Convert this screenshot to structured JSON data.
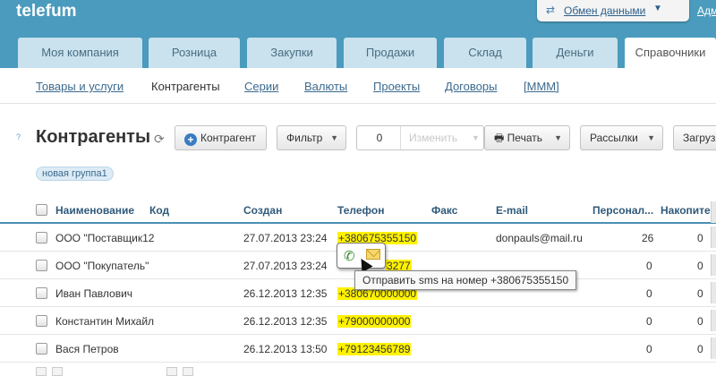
{
  "header": {
    "logo": "telefum",
    "exchange_label": "Обмен данными",
    "admin_label": "Адм"
  },
  "tabs": [
    {
      "label": "Моя компания"
    },
    {
      "label": "Розница"
    },
    {
      "label": "Закупки"
    },
    {
      "label": "Продажи"
    },
    {
      "label": "Склад"
    },
    {
      "label": "Деньги"
    },
    {
      "label": "Справочники"
    }
  ],
  "subnav": [
    {
      "label": "Товары и услуги"
    },
    {
      "label": "Контрагенты"
    },
    {
      "label": "Серии"
    },
    {
      "label": "Валюты"
    },
    {
      "label": "Проекты"
    },
    {
      "label": "Договоры"
    },
    {
      "label": "[МММ]"
    }
  ],
  "page": {
    "help": "?",
    "title": "Контрагенты",
    "refresh_icon": "refresh-icon"
  },
  "toolbar": {
    "add_label": "Контрагент",
    "filter_label": "Фильтр",
    "counter_value": "0",
    "edit_label": "Изменить",
    "print_label": "Печать",
    "mailing_label": "Рассылки",
    "load_label": "Загруз"
  },
  "group_tag": "новая группа1",
  "table": {
    "headers": {
      "name": "Наименование",
      "code": "Код",
      "created": "Создан",
      "phone": "Телефон",
      "fax": "Факс",
      "email": "E-mail",
      "personal": "Персонал...",
      "accum": "Накопите..."
    },
    "rows": [
      {
        "name": "ООО \"Поставщик12",
        "created": "27.07.2013 23:24",
        "phone": "+380675355150",
        "email": "donpauls@mail.ru",
        "personal": "26",
        "accum": "0"
      },
      {
        "name": "ООО \"Покупатель\"",
        "created": "27.07.2013 23:24",
        "phone": "3277",
        "email": "",
        "personal": "0",
        "accum": "0"
      },
      {
        "name": "Иван Павлович",
        "created": "26.12.2013 12:35",
        "phone": "+380670000000",
        "email": "",
        "personal": "0",
        "accum": "0"
      },
      {
        "name": "Константин Михайл",
        "created": "26.12.2013 12:35",
        "phone": "+79000000000",
        "email": "",
        "personal": "0",
        "accum": "0"
      },
      {
        "name": "Вася Петров",
        "created": "26.12.2013 13:50",
        "phone": "+79123456789",
        "email": "",
        "personal": "0",
        "accum": "0"
      }
    ]
  },
  "popup": {
    "phone_icon": "phone-icon",
    "mail_icon": "envelope-icon",
    "hint": "Отправить sms на номер +380675355150"
  },
  "colors": {
    "topbar": "#4a9bbd",
    "tab": "#c9e2ee",
    "phone_highlight": "#fff200",
    "table_rule": "#4a8fb3"
  }
}
